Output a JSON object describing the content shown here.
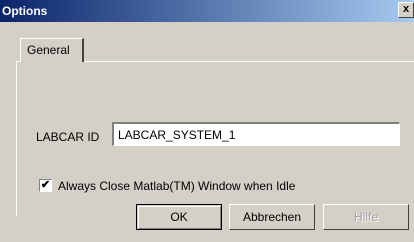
{
  "window": {
    "title": "Options",
    "close_glyph": "x"
  },
  "tabs": [
    {
      "label": "General",
      "selected": true
    }
  ],
  "form": {
    "labcar_id_label": "LABCAR ID",
    "labcar_id_value": "LABCAR_SYSTEM_1",
    "always_close_label": "Always Close Matlab(TM) Window when Idle",
    "always_close_checked": true,
    "check_glyph": "✔"
  },
  "buttons": {
    "ok_label": "OK",
    "cancel_label": "Abbrechen",
    "help_label": "Hilfe",
    "help_enabled": false
  },
  "colors": {
    "titlebar_start": "#0a246a",
    "titlebar_end": "#a6caf0",
    "dialog_face": "#d4d0c8"
  }
}
